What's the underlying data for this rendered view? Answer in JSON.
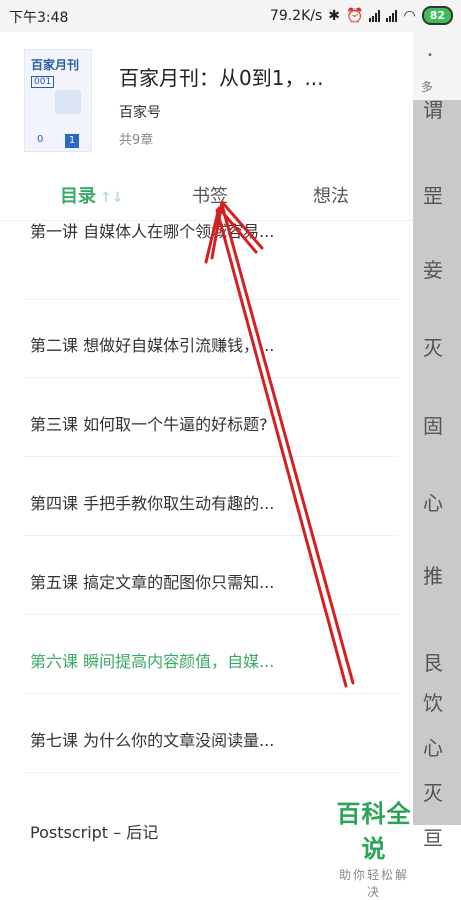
{
  "status_bar": {
    "time": "下午3:48",
    "speed": "79.2K/s",
    "battery": "82"
  },
  "book": {
    "title": "百家月刊：从0到1，...",
    "author": "百家号",
    "chapter_count": "共9章",
    "cover": {
      "title": "百家月刊",
      "issue": "001",
      "zero": "0",
      "one": "1"
    }
  },
  "tabs": [
    {
      "label": "目录",
      "active": true
    },
    {
      "label": "书签",
      "active": false
    },
    {
      "label": "想法",
      "active": false
    }
  ],
  "sort_icon": "↑↓",
  "chapters": [
    {
      "title": "第一讲 自媒体人在哪个领域容易...",
      "active": false
    },
    {
      "title": "第二课 想做好自媒体引流赚钱，...",
      "active": false
    },
    {
      "title": "第三课 如何取一个牛逼的好标题?",
      "active": false
    },
    {
      "title": "第四课 手把手教你取生动有趣的...",
      "active": false
    },
    {
      "title": "第五课 搞定文章的配图你只需知...",
      "active": false
    },
    {
      "title": "第六课 瞬间提高内容颜值，自媒...",
      "active": true
    },
    {
      "title": "第七课 为什么你的文章没阅读量...",
      "active": false
    },
    {
      "title": "Postscript – 后记",
      "active": false
    }
  ],
  "background_page": {
    "dot": "•",
    "more": "多",
    "glyphs": [
      "谓",
      "罡",
      "妾",
      "灭",
      "固",
      "心",
      "推",
      "艮",
      "饮",
      "心",
      "灭",
      "亘"
    ]
  },
  "watermark": {
    "brand": "百科全说",
    "slogan": "助你轻松解决"
  },
  "colors": {
    "accent": "#3aaa66",
    "annotation_arrow": "#d42020"
  }
}
